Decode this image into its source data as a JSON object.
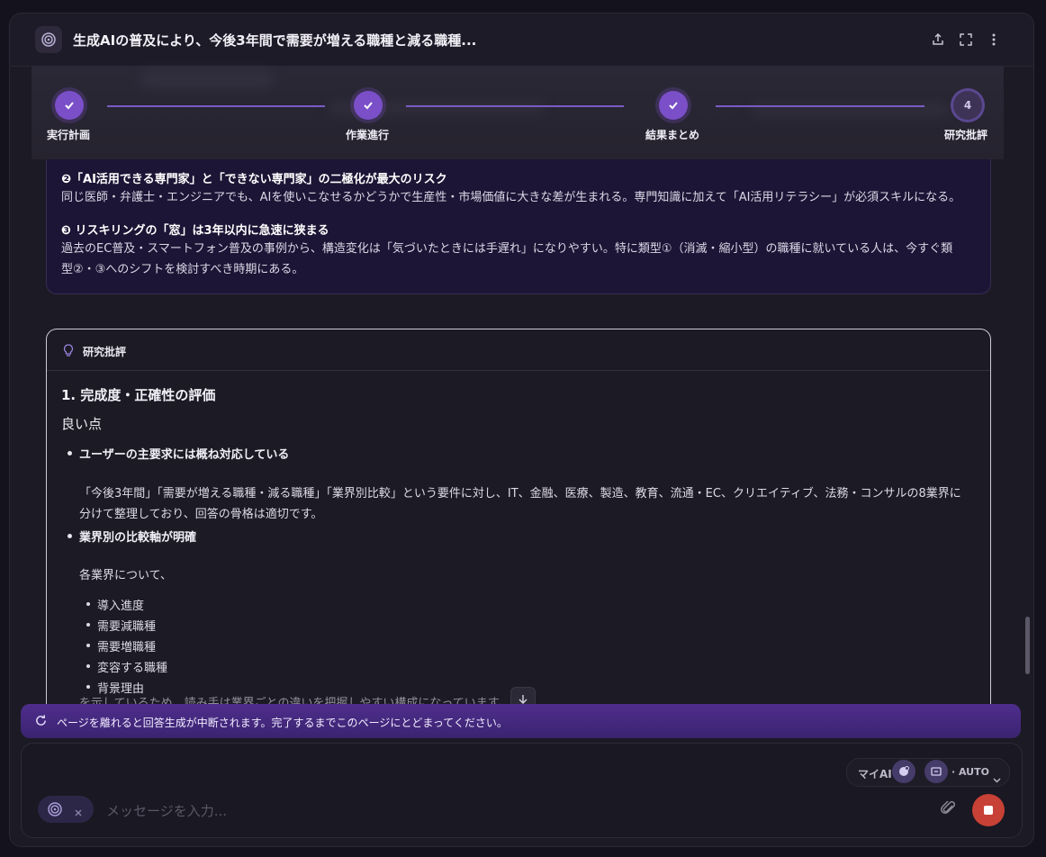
{
  "header": {
    "title": "生成AIの普及により、今後3年間で需要が増える職種と減る職種...",
    "icons": [
      "share-icon",
      "expand-icon",
      "more-vertical-icon"
    ]
  },
  "progress": {
    "steps": [
      {
        "label": "実行計画",
        "state": "done"
      },
      {
        "label": "作業進行",
        "state": "done"
      },
      {
        "label": "結果まとめ",
        "state": "done"
      },
      {
        "label": "研究批評",
        "state": "current",
        "number": "4"
      }
    ]
  },
  "summary": {
    "item2_title": "❷「AI活用できる専門家」と「できない専門家」の二極化が最大のリスク",
    "item2_text": "同じ医師・弁護士・エンジニアでも、AIを使いこなせるかどうかで生産性・市場価値に大きな差が生まれる。専門知識に加えて「AI活用リテラシー」が必須スキルになる。",
    "item3_title": "❸ リスキリングの「窓」は3年以内に急速に狭まる",
    "item3_text_line1": "過去のEC普及・スマートフォン普及の事例から、構造変化は「気づいたときには手遅れ」になりやすい。特に類型①（消滅・縮小型）の職種に就いている人は、今すぐ類",
    "item3_text_line2": "型②・③へのシフトを検討すべき時期にある。"
  },
  "critique": {
    "section_title": "研究批評",
    "h1": "1. 完成度・正確性の評価",
    "good_points": "良い点",
    "bullet1_title": "ユーザーの主要求には概ね対応している",
    "bullet1_line1": "「今後3年間」「需要が増える職種・減る職種」「業界別比較」という要件に対し、IT、金融、医療、製造、教育、流通・EC、クリエイティブ、法務・コンサルの8業界に",
    "bullet1_line2": "分けて整理しており、回答の骨格は適切です。",
    "bullet2_title": "業界別の比較軸が明確",
    "bullet2_intro": "各業界について、",
    "sub_items": [
      "導入進度",
      "需要減職種",
      "需要増職種",
      "変容する職種",
      "背景理由"
    ],
    "cut_line": "を示しているため、読み手は業界ごとの違いを把握しやすい構成になっています。"
  },
  "banner": {
    "text": "ページを離れると回答生成が中断されます。完了するまでこのページにとどまってください。"
  },
  "input": {
    "placeholder": "メッセージを入力...",
    "model_label": "マイAI",
    "mode_label": "· AUTO"
  },
  "colors": {
    "accent": "#7a4fc8",
    "stop": "#c84136",
    "banner": "#4e2d8c"
  }
}
